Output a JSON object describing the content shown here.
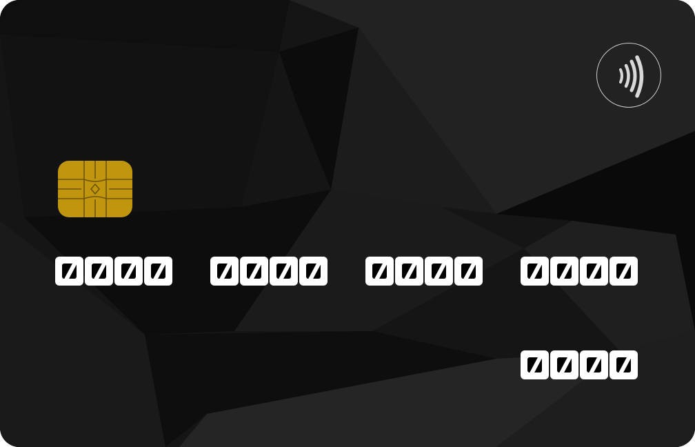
{
  "card": {
    "number_groups": [
      "0000",
      "0000",
      "0000",
      "0000"
    ],
    "expiry": "0000",
    "colors": {
      "background": "#141414",
      "chip": "#c0960e",
      "digits": "#ffffff",
      "contactless_icon": "#d8d8d8"
    },
    "icons": {
      "contactless": "contactless-icon",
      "chip": "chip-icon"
    }
  }
}
